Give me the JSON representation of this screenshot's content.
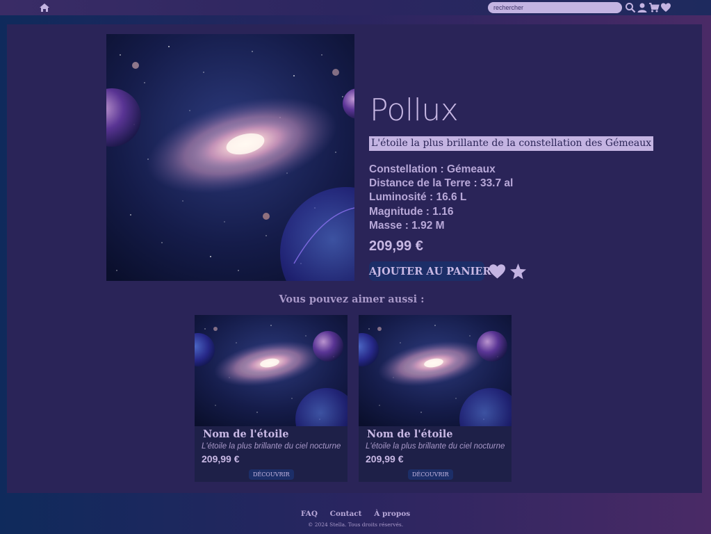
{
  "header": {
    "icons": [
      "home-icon",
      "search-icon",
      "user-icon",
      "cart-icon",
      "heart-icon"
    ],
    "search_placeholder": "rechercher"
  },
  "product": {
    "name": "Pollux",
    "tagline": "L'étoile la plus brillante de la constellation des Gémeaux",
    "specs": [
      "Constellation : Gémeaux",
      "Distance de la Terre : 33.7 al",
      "Luminosité : 16.6 L",
      "Magnitude : 1.16",
      "Masse : 1.92 M"
    ],
    "price": "209,99 €",
    "add_to_cart_label": "AJOUTER AU PANIER",
    "icons": [
      "heart-icon",
      "star-icon"
    ]
  },
  "related": {
    "title": "Vous pouvez aimer aussi :",
    "cards": [
      {
        "name": "Nom de l'étoile",
        "description": "L'étoile la plus brillante du ciel nocturne",
        "price": "209,99 €",
        "button_label": "DÉCOUVRIR"
      },
      {
        "name": "Nom de l'étoile",
        "description": "L'étoile la plus brillante du ciel nocturne",
        "price": "209,99 €",
        "button_label": "DÉCOUVRIR"
      }
    ]
  },
  "footer": {
    "links": [
      "FAQ",
      "Contact",
      "À propos"
    ],
    "copyright": "© 2024 Stella. Tous droits réservés."
  },
  "colors": {
    "accent": "#c4b4e2",
    "panel": "#2a2458",
    "button": "#1c2e68",
    "text": "#c8b8e4"
  }
}
